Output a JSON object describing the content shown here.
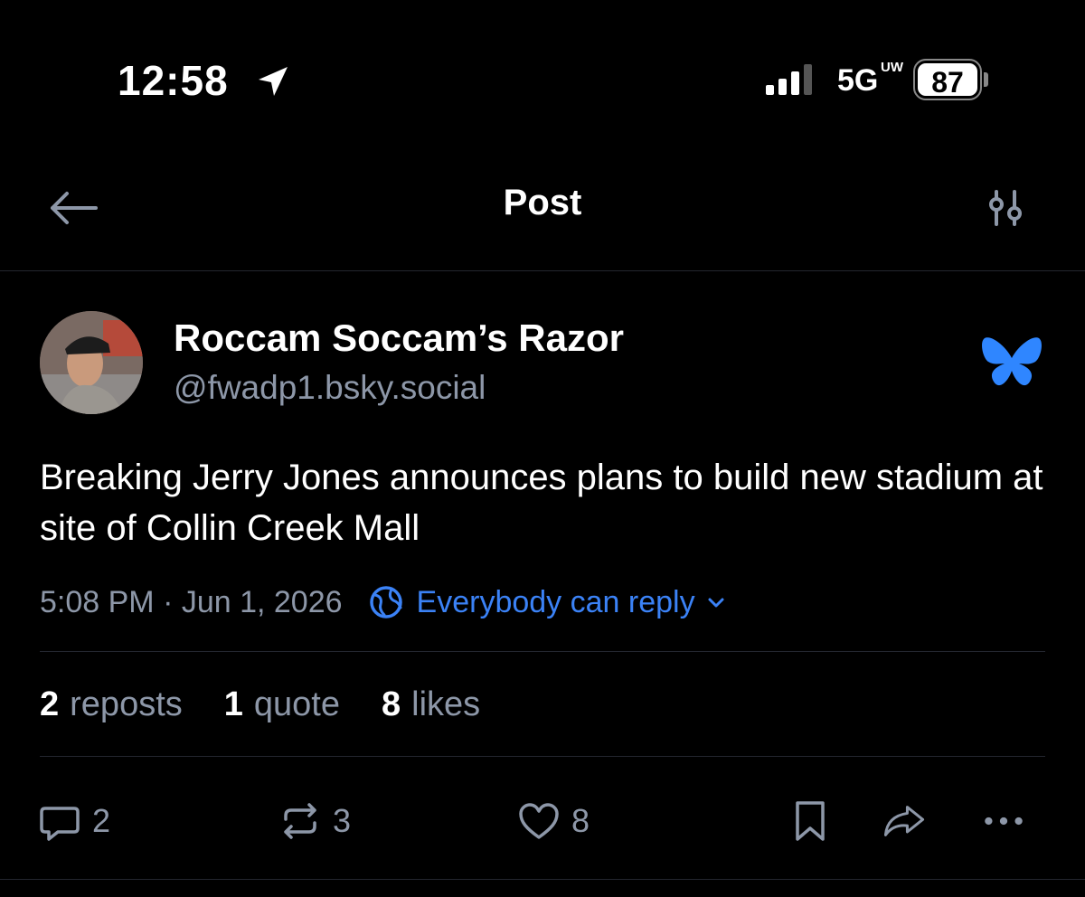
{
  "status_bar": {
    "time": "12:58",
    "network": "5G",
    "network_sup": "UW",
    "battery": "87"
  },
  "header": {
    "title": "Post"
  },
  "post": {
    "author_name": "Roccam Soccam’s Razor",
    "author_handle": "@fwadp1.bsky.social",
    "text": "Breaking Jerry Jones announces plans to build new stadium at site of Collin Creek Mall",
    "timestamp": "5:08 PM · Jun 1, 2026",
    "reply_setting": "Everybody can reply",
    "stats": {
      "reposts_num": "2",
      "reposts_label": "reposts",
      "quotes_num": "1",
      "quotes_label": "quote",
      "likes_num": "8",
      "likes_label": "likes"
    },
    "actions": {
      "replies": "2",
      "reposts": "3",
      "likes": "8"
    }
  },
  "colors": {
    "background": "#000000",
    "muted_text": "#8d97a8",
    "accent_blue": "#3b82f6",
    "divider": "#23262f"
  },
  "icons": [
    "location-arrow-icon",
    "signal-icon",
    "back-arrow-icon",
    "filter-sliders-icon",
    "bluesky-butterfly-icon",
    "globe-icon",
    "chevron-down-icon",
    "reply-icon",
    "repost-icon",
    "like-icon",
    "bookmark-icon",
    "share-icon",
    "more-icon"
  ]
}
